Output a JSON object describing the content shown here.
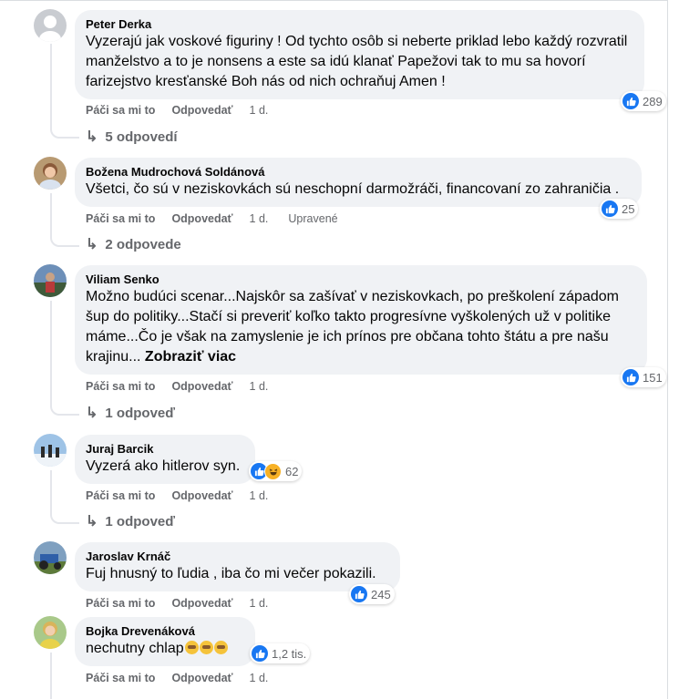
{
  "comments": [
    {
      "author": "Peter Derka",
      "text": "Vyzerajú jak voskové figuriny ! Od tychto osôb si neberte priklad lebo každý rozvratil manželstvo a to je nonsens a este sa idú klanať Papežovi tak to mu sa hovorí farizejstvo kresťanské Boh nás od nich ochraňuj Amen !",
      "reactions": "289",
      "like": "Páči sa mi to",
      "reply": "Odpovedať",
      "time": "1 d.",
      "replies": "5 odpovedí"
    },
    {
      "author": "Božena Mudrochová Soldánová",
      "text": "Všetci, čo sú v neziskovkách sú neschopní darmožráči, financovaní zo zahraničia .",
      "reactions": "25",
      "like": "Páči sa mi to",
      "reply": "Odpovedať",
      "time": "1 d.",
      "edited": "Upravené",
      "replies": "2 odpovede"
    },
    {
      "author": "Viliam Senko",
      "text": "Možno budúci scenar...Najskôr sa zašívať v neziskovkach, po preškolení západom šup do politiky...Stačí si preveriť koľko takto progresívne vyškolených už v politike máme...Čo je však na zamyslenie je ich prínos pre občana tohto štátu a pre našu krajinu...",
      "see_more": "Zobraziť viac",
      "reactions": "151",
      "like": "Páči sa mi to",
      "reply": "Odpovedať",
      "time": "1 d.",
      "replies": "1 odpoveď"
    },
    {
      "author": "Juraj Barcik",
      "text": "Vyzerá ako hitlerov syn.",
      "reactions": "62",
      "like": "Páči sa mi to",
      "reply": "Odpovedať",
      "time": "1 d.",
      "replies": "1 odpoveď"
    },
    {
      "author": "Jaroslav Krnáč",
      "text": "Fuj hnusný to ľudia , iba čo mi večer pokazili.",
      "reactions": "245",
      "like": "Páči sa mi to",
      "reply": "Odpovedať",
      "time": "1 d."
    },
    {
      "author": "Bojka Drevenáková",
      "text": "nechutny chlap",
      "reactions": "1,2 tis.",
      "like": "Páči sa mi to",
      "reply": "Odpovedať",
      "time": "1 d."
    }
  ],
  "colors": {
    "like_blue": "#1877f2",
    "bubble_bg": "#f0f2f5",
    "meta_gray": "#65676b"
  },
  "icons": [
    "like-icon",
    "haha-icon",
    "reply-arrow-icon",
    "see-no-evil-monkey-emoji"
  ]
}
